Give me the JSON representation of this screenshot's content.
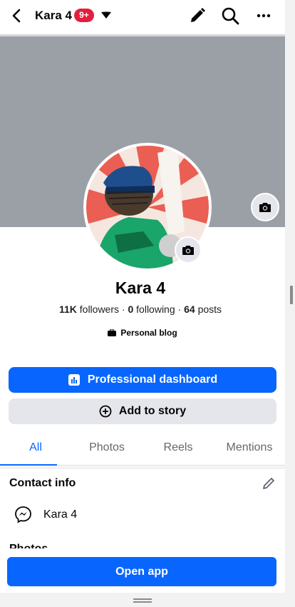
{
  "header": {
    "title": "Kara 4",
    "badge": "9+",
    "icons": [
      "back-arrow-icon",
      "caret-down-icon",
      "pencil-icon",
      "search-icon",
      "more-icon"
    ]
  },
  "profile": {
    "name": "Kara 4",
    "followers_count": "11K",
    "followers_label": "followers",
    "following_count": "0",
    "following_label": "following",
    "posts_count": "64",
    "posts_label": "posts",
    "separator": "·",
    "category": "Personal blog"
  },
  "actions": {
    "dashboard_label": "Professional dashboard",
    "add_story_label": "Add to story"
  },
  "tabs": [
    {
      "label": "All",
      "active": true
    },
    {
      "label": "Photos",
      "active": false
    },
    {
      "label": "Reels",
      "active": false
    },
    {
      "label": "Mentions",
      "active": false
    }
  ],
  "contact_info": {
    "title": "Contact info",
    "messenger_name": "Kara 4"
  },
  "photos_section": {
    "title": "Photos"
  },
  "footer": {
    "open_app_label": "Open app"
  },
  "colors": {
    "primary": "#0866ff",
    "badge": "#e41e3f",
    "cover": "#9aa0a6",
    "secondary_button": "#e4e6eb"
  }
}
